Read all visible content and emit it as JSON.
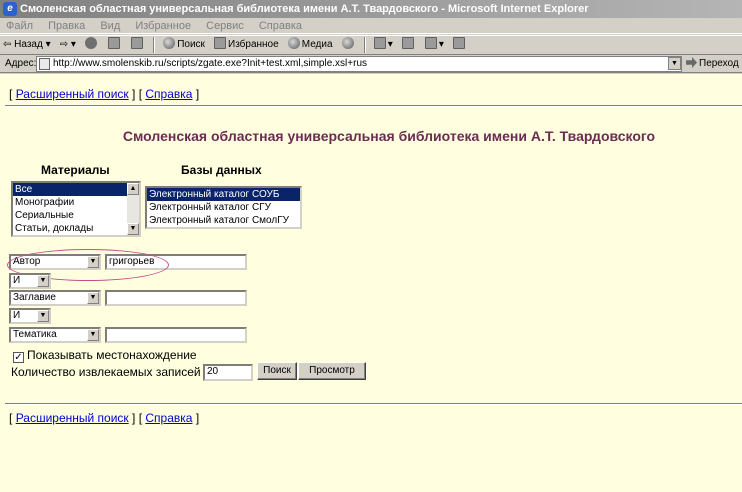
{
  "window": {
    "title": "Смоленская областная универсальная библиотека имени А.Т. Твардовского - Microsoft Internet Explorer"
  },
  "menu": [
    "Файл",
    "Правка",
    "Вид",
    "Избранное",
    "Сервис",
    "Справка"
  ],
  "toolbar": {
    "back_label": "Назад",
    "search_label": "Поиск",
    "favorites_label": "Избранное",
    "media_label": "Медиа"
  },
  "address": {
    "label": "Адрес:",
    "url": "http://www.smolenskib.ru/scripts/zgate.exe?Init+test.xml,simple.xsl+rus",
    "go_label": "Переход"
  },
  "page": {
    "top_links": {
      "open_bracket": "[",
      "advanced_search": "Расширенный поиск",
      "middle": "] [",
      "help": "Справка",
      "close_bracket": "]"
    },
    "heading": "Смоленская областная универсальная библиотека имени А.Т. Твардовского",
    "materials_label": "Материалы",
    "databases_label": "Базы данных",
    "materials_options": [
      "Все",
      "Монографии",
      "Сериальные",
      "Статьи, доклады"
    ],
    "materials_selected": "Все",
    "databases_options": [
      "Электронный каталог СОУБ",
      "Электронный каталог СГУ",
      "Электронный каталог СмолГУ"
    ],
    "databases_selected": "Электронный каталог СОУБ",
    "search_rows": [
      {
        "field": "Автор",
        "value": "григорьев"
      },
      {
        "field": "Заглавие",
        "value": ""
      },
      {
        "field": "Тематика",
        "value": ""
      }
    ],
    "operators": [
      "И",
      "И"
    ],
    "show_location_label": "Показывать местонахождение",
    "show_location_checked": true,
    "records_count_label": "Количество извлекаемых записей",
    "records_count_value": "20",
    "search_button": "Поиск",
    "browse_button": "Просмотр"
  }
}
